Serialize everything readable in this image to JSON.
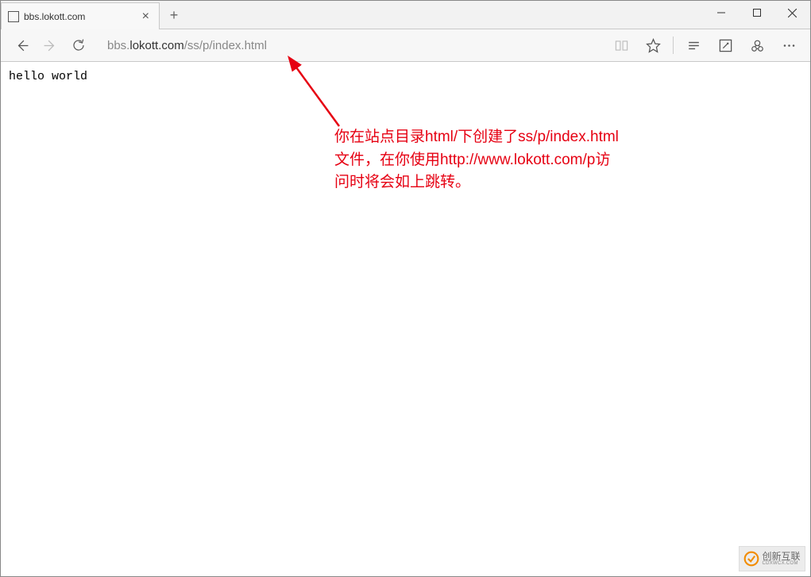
{
  "tab": {
    "title": "bbs.lokott.com"
  },
  "url": {
    "prefix": "bbs.",
    "host": "lokott.com",
    "path": "/ss/p/index.html"
  },
  "page": {
    "content": "hello world"
  },
  "annotation": {
    "line1": "你在站点目录html/下创建了ss/p/index.html",
    "line2": "文件，在你使用http://www.lokott.com/p访",
    "line3": "问时将会如上跳转。"
  },
  "watermark": {
    "brand_cn": "创新互联",
    "brand_en": "CDXWCX.COM"
  }
}
